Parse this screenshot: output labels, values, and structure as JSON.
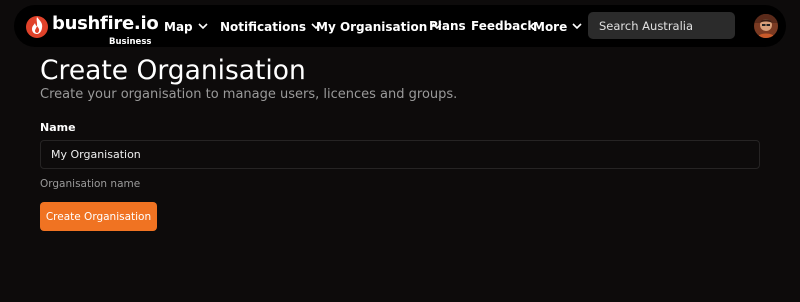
{
  "navbar": {
    "brand": "bushfire.io",
    "brand_sub": "Business",
    "items": [
      {
        "label": "Map",
        "has_dropdown": true
      },
      {
        "label": "Notifications",
        "has_dropdown": true
      },
      {
        "label": "My Organisation",
        "has_dropdown": true
      },
      {
        "label": "Plans",
        "has_dropdown": false
      },
      {
        "label": "Feedback",
        "has_dropdown": false
      },
      {
        "label": "More",
        "has_dropdown": true
      }
    ],
    "search_placeholder": "Search Australia"
  },
  "page": {
    "title": "Create Organisation",
    "subtitle": "Create your organisation to manage users, licences and groups."
  },
  "form": {
    "name_label": "Name",
    "name_value": "My Organisation",
    "name_hint": "Organisation name",
    "submit_label": "Create Organisation"
  },
  "colors": {
    "accent": "#f07322",
    "background": "#0d0b0b",
    "navbar": "#000000"
  }
}
